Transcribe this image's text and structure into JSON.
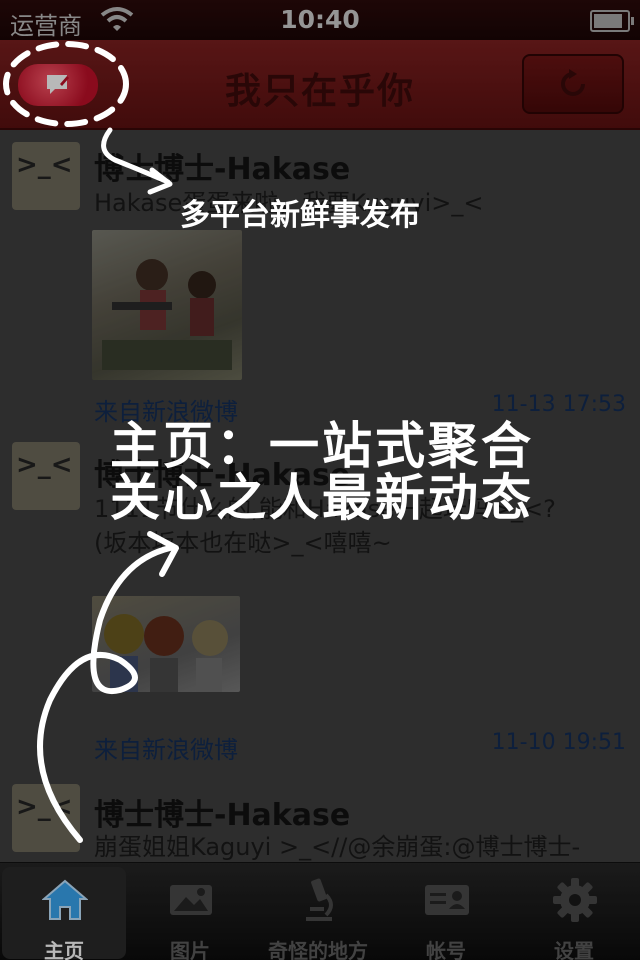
{
  "status_bar": {
    "carrier": "运营商",
    "time": "10:40"
  },
  "nav": {
    "title": "我只在乎你"
  },
  "posts": [
    {
      "username": "博士博士-Hakase",
      "text": [
        "Hakase蛋蛋来啦，我要Kuguyi>_<"
      ],
      "source": "来自新浪微博",
      "time": "11-13 17:53"
    },
    {
      "username": "博士博士-Hakase",
      "text": [
        "1111节什么的,能和Hakase一起玩吗>_<?",
        "(坂本坂本也在哒>_<嘻嘻~"
      ],
      "source": "来自新浪微博",
      "time": "11-10 19:51"
    },
    {
      "username": "博士博士-Hakase",
      "text": [
        "崩蛋姐姐Kaguyi >_<//@余崩蛋:@博士博士-"
      ]
    }
  ],
  "overlay": {
    "compose_hint": "多平台新鲜事发布",
    "home_hint_line1": "主页：一站式聚合",
    "home_hint_line2": "关心之人最新动态"
  },
  "tabs": [
    {
      "label": "主页",
      "icon": "home-icon",
      "active": true
    },
    {
      "label": "图片",
      "icon": "picture-icon",
      "active": false
    },
    {
      "label": "奇怪的地方",
      "icon": "microscope-icon",
      "active": false
    },
    {
      "label": "帐号",
      "icon": "account-card-icon",
      "active": false
    },
    {
      "label": "设置",
      "icon": "gear-icon",
      "active": false
    }
  ],
  "colors": {
    "nav_bar": "#5b1010",
    "compose_button": "#c01029",
    "link": "#122c54",
    "overlay": "#ffffff"
  }
}
